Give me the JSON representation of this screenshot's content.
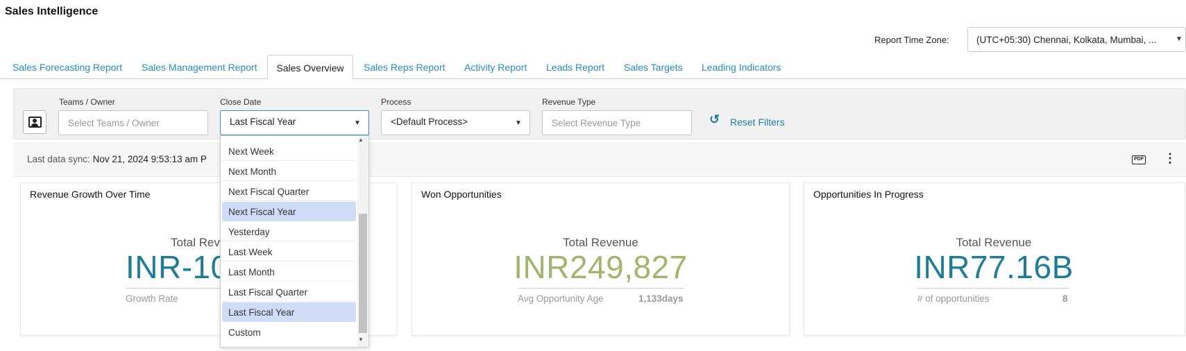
{
  "app": {
    "title": "Sales Intelligence"
  },
  "timezone": {
    "label": "Report Time Zone:",
    "value": "(UTC+05:30) Chennai, Kolkata, Mumbai, ..."
  },
  "tabs": [
    {
      "label": "Sales Forecasting Report"
    },
    {
      "label": "Sales Management Report"
    },
    {
      "label": "Sales Overview"
    },
    {
      "label": "Sales Reps Report"
    },
    {
      "label": "Activity Report"
    },
    {
      "label": "Leads Report"
    },
    {
      "label": "Sales Targets"
    },
    {
      "label": "Leading Indicators"
    }
  ],
  "active_tab": "Sales Overview",
  "filters": {
    "teams": {
      "label": "Teams / Owner",
      "placeholder": "Select Teams / Owner"
    },
    "close_date": {
      "label": "Close Date",
      "value": "Last Fiscal Year"
    },
    "process": {
      "label": "Process",
      "value": "<Default Process>"
    },
    "revenue_type": {
      "label": "Revenue Type",
      "placeholder": "Select Revenue Type"
    },
    "reset_label": "Reset Filters"
  },
  "sync": {
    "label": "Last data sync:",
    "value": "Nov 21, 2024 9:53:13 am P"
  },
  "cards": {
    "revenue_growth": {
      "title": "Revenue Growth Over Time",
      "sub": "Total Reve",
      "big": "INR-10",
      "meta_label": "Growth Rate"
    },
    "won": {
      "title": "Won Opportunities",
      "sub": "Total Revenue",
      "big": "INR249,827",
      "meta_label": "Avg Opportunity Age",
      "meta_value": "1,133days"
    },
    "in_progress": {
      "title": "Opportunities In Progress",
      "sub": "Total Revenue",
      "big": "INR77.16B",
      "meta_label": "# of opportunities",
      "meta_value": "8"
    }
  },
  "dropdown": {
    "options": [
      {
        "label": "Next Week"
      },
      {
        "label": "Next Month"
      },
      {
        "label": "Next Fiscal Quarter"
      },
      {
        "label": "Next Fiscal Year"
      },
      {
        "label": "Yesterday"
      },
      {
        "label": "Last Week"
      },
      {
        "label": "Last Month"
      },
      {
        "label": "Last Fiscal Quarter"
      },
      {
        "label": "Last Fiscal Year"
      },
      {
        "label": "Custom"
      }
    ],
    "highlighted": [
      "Next Fiscal Year",
      "Last Fiscal Year"
    ]
  },
  "colors": {
    "accent": "#2a8bc0",
    "won_green": "#a3b56b",
    "teal": "#1d7d99",
    "highlight": "#cfdcf8"
  },
  "icons": {
    "contact": "contact-card-icon",
    "reset": "reset-icon",
    "pdf": "pdf-icon",
    "more": "more-vertical-icon",
    "caret": "caret-down-icon"
  }
}
